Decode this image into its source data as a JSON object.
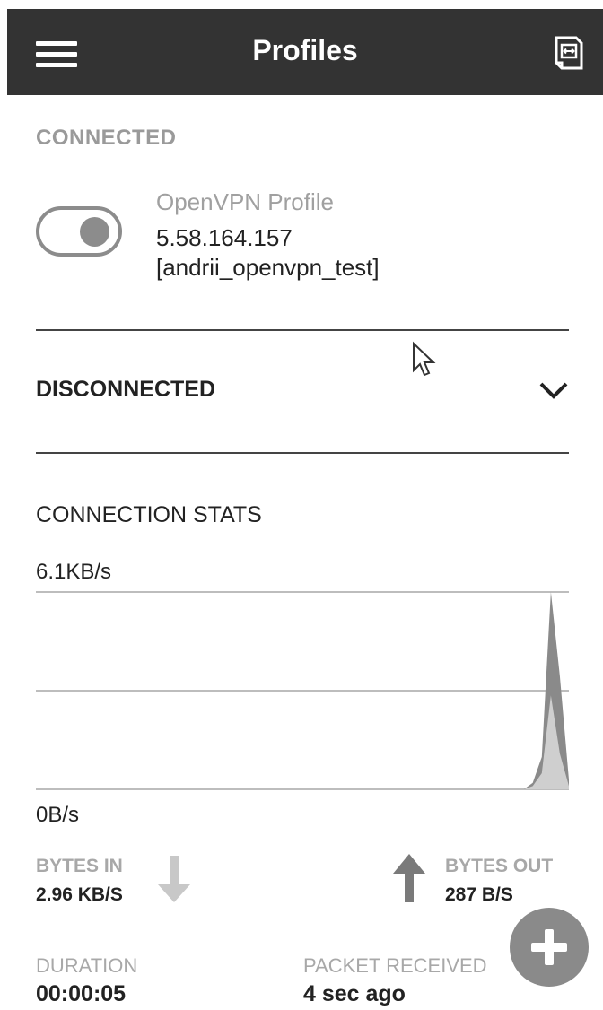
{
  "header": {
    "title": "Profiles",
    "menu_icon": "hamburger-menu-icon",
    "import_icon": "import-profile-icon"
  },
  "connected_section": {
    "label": "CONNECTED",
    "profile": {
      "name": "OpenVPN Profile",
      "host": "5.58.164.157",
      "username": "[andrii_openvpn_test]",
      "toggle_on": true
    }
  },
  "disconnected_section": {
    "label": "DISCONNECTED",
    "icon": "chevron-down-icon"
  },
  "stats": {
    "title": "CONNECTION STATS",
    "y_max_label": "6.1KB/s",
    "y_min_label": "0B/s",
    "bytes_in": {
      "label": "BYTES IN",
      "value": "2.96 KB/S",
      "icon": "arrow-down-icon"
    },
    "bytes_out": {
      "label": "BYTES OUT",
      "value": "287 B/S",
      "icon": "arrow-up-icon"
    },
    "duration": {
      "label": "DURATION",
      "value": "00:00:05"
    },
    "packet_received": {
      "label": "PACKET RECEIVED",
      "value": "4 sec ago"
    }
  },
  "fab": {
    "icon": "plus-icon"
  },
  "colors": {
    "topbar": "#333333",
    "muted_text": "#a0a0a0",
    "series_dark": "#8a8a8a",
    "series_light": "#cfcfcf"
  },
  "chart_data": {
    "type": "area",
    "ylim": [
      0,
      6.1
    ],
    "ylabel_unit": "KB/s",
    "grid": true,
    "series": [
      {
        "values": [
          0,
          0,
          0,
          0,
          0,
          0,
          0,
          0,
          0,
          0,
          0,
          0,
          0,
          0,
          0,
          0,
          0,
          0,
          0,
          0,
          0,
          0,
          0,
          0,
          0,
          0,
          0,
          0,
          0,
          0,
          0,
          0,
          0,
          0,
          0,
          0,
          0,
          0,
          0,
          0,
          0,
          0,
          0,
          0,
          0,
          0,
          0,
          0,
          0,
          0,
          0,
          0,
          0,
          0,
          0,
          0.2,
          1.0,
          6.1,
          3.5,
          0.3
        ]
      },
      {
        "values": [
          0,
          0,
          0,
          0,
          0,
          0,
          0,
          0,
          0,
          0,
          0,
          0,
          0,
          0,
          0,
          0,
          0,
          0,
          0,
          0,
          0,
          0,
          0,
          0,
          0,
          0,
          0,
          0,
          0,
          0,
          0,
          0,
          0,
          0,
          0,
          0,
          0,
          0,
          0,
          0,
          0,
          0,
          0,
          0,
          0,
          0,
          0,
          0,
          0,
          0,
          0,
          0,
          0,
          0,
          0,
          0.1,
          0.5,
          2.9,
          1.1,
          0.1
        ]
      }
    ]
  }
}
